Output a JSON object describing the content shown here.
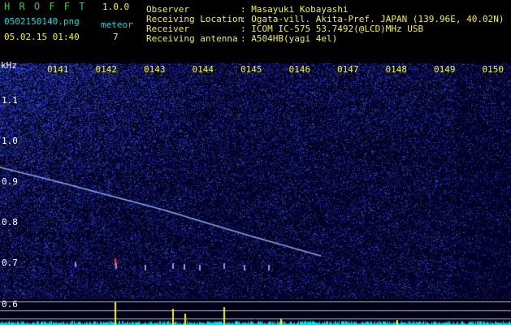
{
  "header": {
    "app_name": "H R O F F T",
    "version": "1.0.0",
    "filename": "0502150140.png",
    "meteor_label": "meteor",
    "meteor_count": "7",
    "datetime": "05.02.15 01:40",
    "fields": [
      {
        "label": "Observer",
        "value": ": Masayuki Kobayashi"
      },
      {
        "label": "Receiving Location",
        "value": ": Ogata-vill. Akita-Pref. JAPAN (139.96E, 40.02N)"
      },
      {
        "label": "Receiver",
        "value": ": ICOM IC-575 53.7492(@LCD)MHz USB"
      },
      {
        "label": "Receiving antenna",
        "value": ": A504HB(yagi 4el)"
      }
    ]
  },
  "spectrogram": {
    "y_unit": "kHz",
    "y_labels": [
      "1.1",
      "1.0",
      "0.9",
      "0.8",
      "0.7",
      "0.6"
    ],
    "time_ticks": [
      "0141",
      "0142",
      "0143",
      "0144",
      "0145",
      "0146",
      "0147",
      "0148",
      "0149",
      "0150"
    ],
    "colors": {
      "background": "#000022",
      "noise": "#2b3cff",
      "trail": "#8fb4ff",
      "grid": "#bbbbbb",
      "peak": "#f5f514",
      "base": "#00ffff"
    }
  }
}
